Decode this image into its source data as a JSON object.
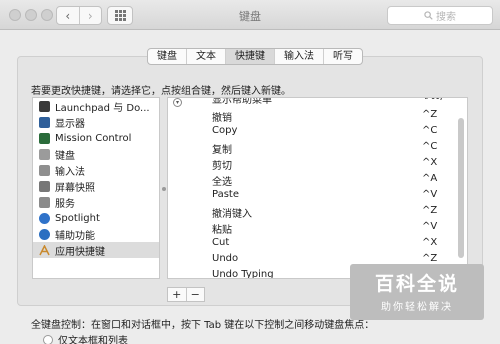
{
  "window": {
    "title": "键盘",
    "search_placeholder": "搜索",
    "back_icon": "‹",
    "forward_icon": "›"
  },
  "tabs": [
    {
      "label": "键盘",
      "active": false
    },
    {
      "label": "文本",
      "active": false
    },
    {
      "label": "快捷键",
      "active": true
    },
    {
      "label": "输入法",
      "active": false
    },
    {
      "label": "听写",
      "active": false
    }
  ],
  "instruction": "若要更改快捷键，请选择它，点按组合键，然后键入新键。",
  "categories": [
    {
      "label": "Launchpad 与 Do...",
      "icon": "launchpad-icon",
      "color": "#3a3a3a"
    },
    {
      "label": "显示器",
      "icon": "display-icon",
      "color": "#2f5f9a"
    },
    {
      "label": "Mission Control",
      "icon": "mission-control-icon",
      "color": "#2a6b3a"
    },
    {
      "label": "键盘",
      "icon": "keyboard-icon",
      "color": "#9b9b9b"
    },
    {
      "label": "输入法",
      "icon": "input-source-icon",
      "color": "#8f8f8f"
    },
    {
      "label": "屏幕快照",
      "icon": "screenshot-icon",
      "color": "#777777"
    },
    {
      "label": "服务",
      "icon": "services-icon",
      "color": "#8a8a8a"
    },
    {
      "label": "Spotlight",
      "icon": "spotlight-icon",
      "color": "#2f72c9"
    },
    {
      "label": "辅助功能",
      "icon": "accessibility-icon",
      "color": "#2a6fc1"
    },
    {
      "label": "应用快捷键",
      "icon": "app-shortcuts-icon",
      "color": "#c98a2e",
      "selected": true
    }
  ],
  "shortcuts": [
    {
      "label": "显示帮助菜单",
      "key": "⇧⌘/"
    },
    {
      "label": "撤销",
      "key": "^Z"
    },
    {
      "label": "Copy",
      "key": "^C"
    },
    {
      "label": "复制",
      "key": "^C"
    },
    {
      "label": "剪切",
      "key": "^X"
    },
    {
      "label": "全选",
      "key": "^A"
    },
    {
      "label": "Paste",
      "key": "^V"
    },
    {
      "label": "撤消键入",
      "key": "^Z"
    },
    {
      "label": "粘贴",
      "key": "^V"
    },
    {
      "label": "Cut",
      "key": "^X"
    },
    {
      "label": "Undo",
      "key": "^Z"
    },
    {
      "label": "Undo Typing",
      "key": ""
    }
  ],
  "list_controls": {
    "add": "+",
    "remove": "−"
  },
  "keyboard_control": "全键盘控制：在窗口和对话框中，按下 Tab 键在以下控制之间移动键盘焦点：",
  "radio_option": "仅文本框和列表",
  "watermark": {
    "title": "百科全说",
    "subtitle": "助你轻松解决"
  }
}
